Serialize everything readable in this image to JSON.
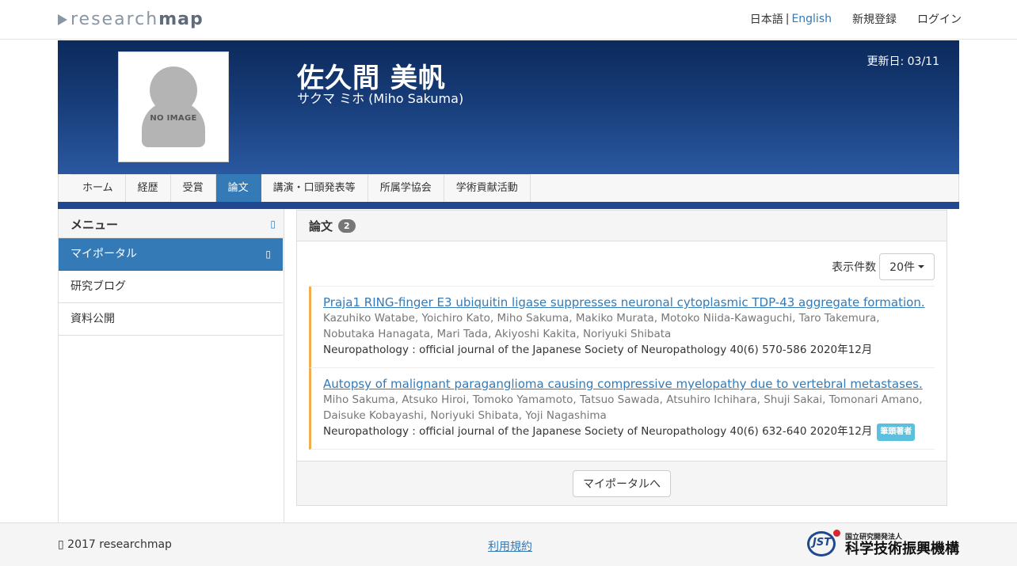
{
  "header": {
    "logo_light": "research",
    "logo_bold": "map",
    "lang_ja": "日本語",
    "lang_sep": "|",
    "lang_en": "English",
    "register": "新規登録",
    "login": "ログイン"
  },
  "profile": {
    "avatar_text": "NO IMAGE",
    "name": "佐久間 美帆",
    "name_kana": "サクマ ミホ  (Miho Sakuma)",
    "updated": "更新日: 03/11"
  },
  "tabs": [
    {
      "label": "ホーム"
    },
    {
      "label": "経歴"
    },
    {
      "label": "受賞"
    },
    {
      "label": "論文"
    },
    {
      "label": "講演・口頭発表等"
    },
    {
      "label": "所属学協会"
    },
    {
      "label": "学術貢献活動"
    }
  ],
  "sidebar": {
    "title": "メニュー",
    "items": [
      {
        "label": "マイポータル"
      },
      {
        "label": "研究ブログ"
      },
      {
        "label": "資料公開"
      }
    ]
  },
  "main": {
    "title": "論文",
    "count": "2",
    "per_page_label": "表示件数",
    "per_page_value": "20件",
    "papers": [
      {
        "title": "Praja1 RING-finger E3 ubiquitin ligase suppresses neuronal cytoplasmic TDP-43 aggregate formation.",
        "authors": "Kazuhiko Watabe, Yoichiro Kato, Miho Sakuma, Makiko Murata, Motoko Niida-Kawaguchi, Taro Takemura, Nobutaka Hanagata, Mari Tada, Akiyoshi Kakita, Noriyuki Shibata",
        "journal": "Neuropathology : official journal of the Japanese Society of Neuropathology 40(6) 570-586 2020年12月"
      },
      {
        "title": "Autopsy of malignant paraganglioma causing compressive myelopathy due to vertebral metastases.",
        "authors": "Miho Sakuma, Atsuko Hiroi, Tomoko Yamamoto, Tatsuo Sawada, Atsuhiro Ichihara, Shuji Sakai, Tomonari Amano, Daisuke Kobayashi, Noriyuki Shibata, Yoji Nagashima",
        "journal": "Neuropathology : official journal of the Japanese Society of Neuropathology 40(6) 632-640 2020年12月",
        "badge": "筆頭著者"
      }
    ],
    "portal_button": "マイポータルへ"
  },
  "footer": {
    "copyright": "2017 researchmap",
    "terms": "利用規約",
    "jst_mark": "JST",
    "jst_small": "国立研究開発法人",
    "jst_name": "科学技術振興機構"
  },
  "colors": {
    "primary": "#337ab7",
    "banner": "#173c78",
    "accent": "#f0ad4e",
    "info": "#5bc0de"
  }
}
